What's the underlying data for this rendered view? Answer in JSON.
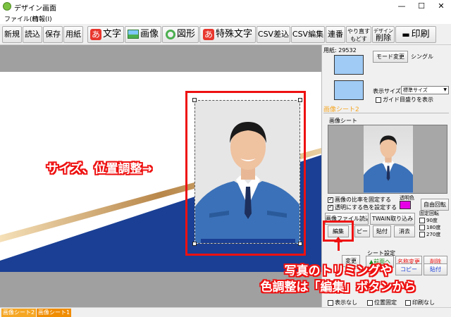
{
  "window": {
    "title": "デザイン画面",
    "minimize": "—",
    "maximize": "☐",
    "close": "✕"
  },
  "menu": {
    "file": "ファイル(F)",
    "info": "情報(I)"
  },
  "toolbar": {
    "new": "新規",
    "load": "読込",
    "save": "保存",
    "paper": "用紙",
    "text_icon": "あ",
    "text": "文字",
    "image": "画像",
    "shape": "図形",
    "special_icon": "あ",
    "special_text": "特殊文字",
    "csv_insert": "CSV差込",
    "csv_edit": "CSV編集",
    "serial": "連番",
    "redo": "やり直す",
    "undo": "もどす",
    "design_delete_top": "デザイン",
    "design_delete": "削除",
    "print": "印刷"
  },
  "callouts": {
    "resize": "サイズ、位置調整→",
    "edit_line1": "写真のトリミングや",
    "edit_line2": "色調整は「編集」ボタンから"
  },
  "panel": {
    "paper_label": "用紙: 29532",
    "mode_change": "モード変更",
    "mode_value": "シングル",
    "display_size_label": "表示サイズ",
    "display_size_value": "標準サイズ",
    "guide_label": "ガイド目盛りを表示",
    "section_title": "画像シート2",
    "sheet_group": "画像シート",
    "fix_ratio": "画像の比率を固定する",
    "transparent_color_set": "透明にする色を設定する",
    "transparent_color": "透明色",
    "free_rotate": "自由回転",
    "fixed_rotate": "固定回転",
    "deg90": "90度",
    "deg180": "180度",
    "deg270": "270度",
    "file_load": "画像ファイル読込",
    "twain": "TWAIN取り込み",
    "edit": "編集",
    "copy": "ピー",
    "paste": "貼付",
    "erase": "消去",
    "change": "変更",
    "sheet_settings": "シート設定",
    "to_front": "▲前面へ",
    "name_change": "名称変更",
    "delete": "削除",
    "copy2": "コピー",
    "paste2": "貼付",
    "hide": "表示なし",
    "fix_position": "位置固定",
    "no_print": "印刷なし"
  },
  "tabs": {
    "sheet2": "画像シート2",
    "sheet1": "画像シート1"
  },
  "colors": {
    "accent_red": "#e11111",
    "brand_blue": "#1a3f94",
    "swatch_blue": "#9fcbf5",
    "magenta": "#e600e6",
    "tab_orange": "#f5a623"
  }
}
